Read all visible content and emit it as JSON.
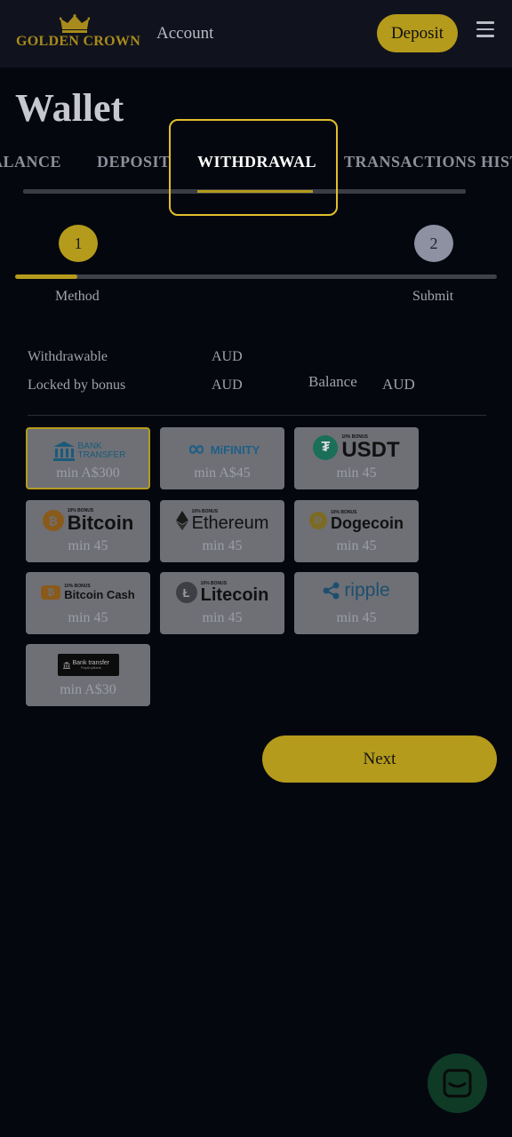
{
  "header": {
    "logo_text": "GOLDEN CROWN",
    "account_label": "Account",
    "deposit_label": "Deposit",
    "menu_icon": "hamburger-menu-icon"
  },
  "page": {
    "title": "Wallet"
  },
  "tabs": [
    {
      "label": "ALANCE",
      "active": false
    },
    {
      "label": "DEPOSIT",
      "active": false
    },
    {
      "label": "WITHDRAWAL",
      "active": true
    },
    {
      "label": "TRANSACTIONS HIST",
      "active": false
    }
  ],
  "steps": [
    {
      "number": "1",
      "label": "Method",
      "active": true
    },
    {
      "number": "2",
      "label": "Submit",
      "active": false
    }
  ],
  "progress_fraction": 0.13,
  "balances": {
    "withdrawable_label": "Withdrawable",
    "withdrawable_currency": "AUD",
    "locked_label": "Locked by bonus",
    "locked_currency": "AUD",
    "balance_label": "Balance",
    "balance_currency": "AUD"
  },
  "methods": [
    {
      "name": "BANK TRANSFER",
      "min": "min A$300",
      "selected": true
    },
    {
      "name": "MiFINITY",
      "min": "min A$45"
    },
    {
      "name": "USDT",
      "bonus": "10% BONUS",
      "min": "min 45"
    },
    {
      "name": "Bitcoin",
      "bonus": "10% BONUS",
      "min": "min 45"
    },
    {
      "name": "Ethereum",
      "bonus": "10% BONUS",
      "min": "min 45"
    },
    {
      "name": "Dogecoin",
      "bonus": "10% BONUS",
      "min": "min 45"
    },
    {
      "name": "Bitcoin Cash",
      "bonus": "10% BONUS",
      "min": "min 45"
    },
    {
      "name": "Litecoin",
      "bonus": "10% BONUS",
      "min": "min 45"
    },
    {
      "name": "ripple",
      "min": "min 45"
    },
    {
      "name": "Bank transfer",
      "sub": "PayAnyBank",
      "min": "min A$30"
    }
  ],
  "next_label": "Next",
  "colors": {
    "accent": "#b59b1c",
    "background": "#05070f",
    "header": "#10131d"
  }
}
